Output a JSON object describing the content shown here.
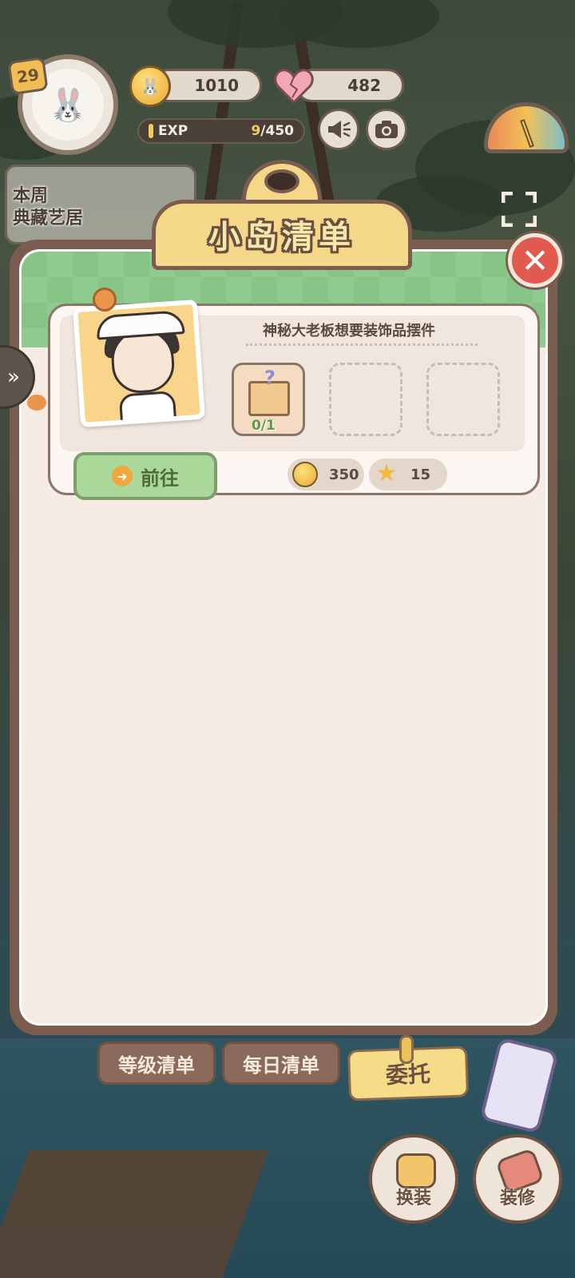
{
  "hud": {
    "level": "29",
    "coins": "1010",
    "hearts": "482",
    "exp_label": "EXP",
    "exp_current": "9",
    "exp_max": "/450",
    "weekly_banner": "本周\n典藏艺居"
  },
  "panel": {
    "title": "小岛清单",
    "task": {
      "description": "神秘大老板想要装饰品摆件",
      "item_progress": "0/1",
      "go_label": "前往",
      "reward_coins": "350",
      "reward_stars": "15"
    }
  },
  "tabs": [
    {
      "label": "等级清单",
      "active": false
    },
    {
      "label": "每日清单",
      "active": false
    },
    {
      "label": "委托",
      "active": true
    }
  ],
  "bottom_buttons": {
    "dress_label": "换装",
    "decorate_label": "装修"
  },
  "icons": {
    "close": "close-icon",
    "sidebar": "chevron-right-icon",
    "speaker": "speaker-icon",
    "camera": "camera-icon"
  },
  "colors": {
    "panel_frame": "#7b5d4f",
    "panel_bg": "#f6ebe4",
    "panel_header_green": "#86c586",
    "close_red": "#e05a4f",
    "go_green": "#a9d898",
    "active_tab": "#f6dc88"
  }
}
